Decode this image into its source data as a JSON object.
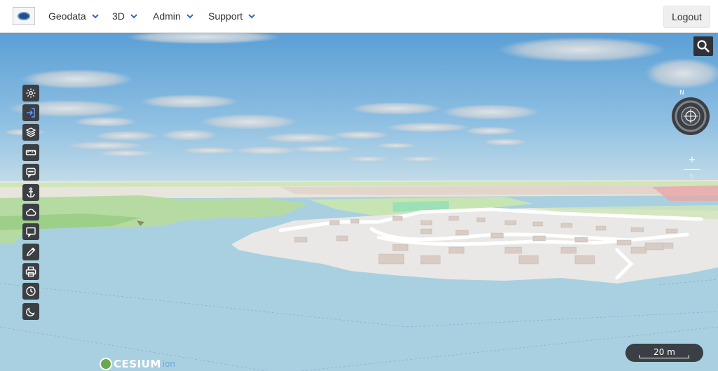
{
  "nav": {
    "logo_icon": "municipality-logo",
    "items": [
      {
        "label": "Geodata"
      },
      {
        "label": "3D"
      },
      {
        "label": "Admin"
      },
      {
        "label": "Support"
      }
    ],
    "logout_label": "Logout",
    "accent_color": "#3366cc"
  },
  "toolbar": {
    "tools": [
      {
        "icon": "settings-icon",
        "active": false
      },
      {
        "icon": "login-icon",
        "active": true
      },
      {
        "icon": "layers-icon",
        "active": false
      },
      {
        "icon": "measure-icon",
        "active": false
      },
      {
        "icon": "chat-icon",
        "active": false
      },
      {
        "icon": "anchor-icon",
        "active": false
      },
      {
        "icon": "cloud-icon",
        "active": false
      },
      {
        "icon": "comment-icon",
        "active": false
      },
      {
        "icon": "pencil-icon",
        "active": false
      },
      {
        "icon": "print-icon",
        "active": false
      },
      {
        "icon": "clock-icon",
        "active": false
      },
      {
        "icon": "moon-icon",
        "active": false
      }
    ]
  },
  "map": {
    "search_icon": "search-icon",
    "compass_label": "N",
    "zoom_in_label": "+",
    "scale_label": "20 m",
    "credit": {
      "brand": "CESIUM",
      "product": "ion"
    }
  }
}
